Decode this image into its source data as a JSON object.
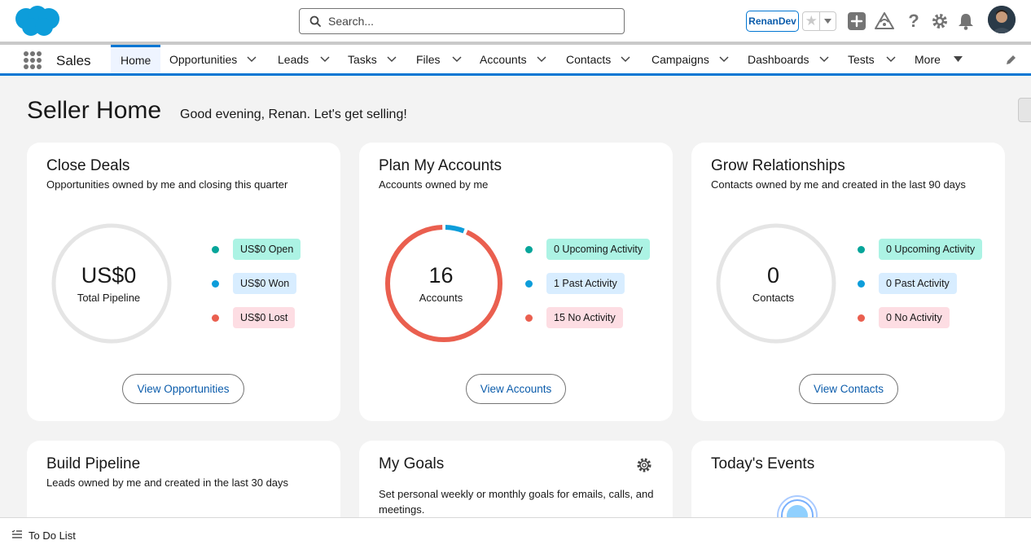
{
  "header": {
    "search_placeholder": "Search...",
    "org_badge": "RenanDev"
  },
  "nav": {
    "app_name": "Sales",
    "tabs": [
      {
        "label": "Home"
      },
      {
        "label": "Opportunities"
      },
      {
        "label": "Leads"
      },
      {
        "label": "Tasks"
      },
      {
        "label": "Files"
      },
      {
        "label": "Accounts"
      },
      {
        "label": "Contacts"
      },
      {
        "label": "Campaigns"
      },
      {
        "label": "Dashboards"
      },
      {
        "label": "Tests"
      },
      {
        "label": "More"
      }
    ]
  },
  "page": {
    "title": "Seller Home",
    "greeting": "Good evening, Renan. Let's get selling!"
  },
  "cards": {
    "close_deals": {
      "title": "Close Deals",
      "subtitle": "Opportunities owned by me and closing this quarter",
      "ring_value": "US$0",
      "ring_label": "Total Pipeline",
      "legend": [
        {
          "label": "US$0 Open",
          "dot": "#06a59a",
          "bg": "#acf3e4"
        },
        {
          "label": "US$0 Won",
          "dot": "#0d9dda",
          "bg": "#d8edff"
        },
        {
          "label": "US$0 Lost",
          "dot": "#ea5f4f",
          "bg": "#fddde3"
        }
      ],
      "button": "View Opportunities"
    },
    "plan_accounts": {
      "title": "Plan My Accounts",
      "subtitle": "Accounts owned by me",
      "ring_value": "16",
      "ring_label": "Accounts",
      "ring_counts": {
        "upcoming": 0,
        "past": 1,
        "none": 15
      },
      "legend": [
        {
          "label": "0 Upcoming Activity",
          "dot": "#06a59a",
          "bg": "#acf3e4"
        },
        {
          "label": "1 Past Activity",
          "dot": "#0d9dda",
          "bg": "#d8edff"
        },
        {
          "label": "15 No Activity",
          "dot": "#ea5f4f",
          "bg": "#fddde3"
        }
      ],
      "button": "View Accounts"
    },
    "grow_relationships": {
      "title": "Grow Relationships",
      "subtitle": "Contacts owned by me and created in the last 90 days",
      "ring_value": "0",
      "ring_label": "Contacts",
      "legend": [
        {
          "label": "0 Upcoming Activity",
          "dot": "#06a59a",
          "bg": "#acf3e4"
        },
        {
          "label": "0 Past Activity",
          "dot": "#0d9dda",
          "bg": "#d8edff"
        },
        {
          "label": "0 No Activity",
          "dot": "#ea5f4f",
          "bg": "#fddde3"
        }
      ],
      "button": "View Contacts"
    },
    "build_pipeline": {
      "title": "Build Pipeline",
      "subtitle": "Leads owned by me and created in the last 30 days"
    },
    "my_goals": {
      "title": "My Goals",
      "description": "Set personal weekly or monthly goals for emails, calls, and meetings."
    },
    "todays_events": {
      "title": "Today's Events"
    }
  },
  "footer": {
    "label": "To Do List"
  },
  "colors": {
    "brand": "#0176d3",
    "link": "#0b5cab",
    "ring_empty": "#e5e5e5",
    "ring_no_activity": "#ea5f4f",
    "ring_past_activity": "#0d9dda"
  },
  "icons": [
    "salesforce-cloud-logo",
    "search-icon",
    "star-icon",
    "chevron-down-icon",
    "add-icon",
    "trailhead-icon",
    "help-icon",
    "gear-icon",
    "bell-icon",
    "app-launcher-icon",
    "pencil-icon",
    "todo-list-icon"
  ]
}
